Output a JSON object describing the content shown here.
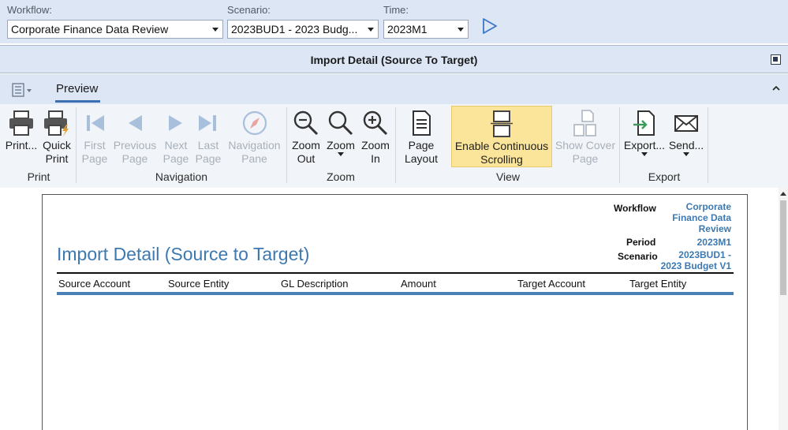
{
  "selectors": {
    "workflow": {
      "label": "Workflow:",
      "value": "Corporate Finance Data Review"
    },
    "scenario": {
      "label": "Scenario:",
      "value": "2023BUD1 - 2023 Budg..."
    },
    "time": {
      "label": "Time:",
      "value": "2023M1"
    }
  },
  "panel": {
    "title": "Import Detail (Source To Target)"
  },
  "tabs": {
    "preview": "Preview"
  },
  "ribbon": {
    "print": {
      "print": [
        "Print..."
      ],
      "quick_print": [
        "Quick",
        "Print"
      ],
      "group": "Print"
    },
    "navigation": {
      "first_page": [
        "First",
        "Page"
      ],
      "previous_page": [
        "Previous",
        "Page"
      ],
      "next_page": [
        "Next",
        "Page"
      ],
      "last_page": [
        "Last",
        "Page"
      ],
      "navigation_pane": [
        "Navigation",
        "Pane"
      ],
      "group": "Navigation"
    },
    "zoom": {
      "zoom_out": [
        "Zoom",
        "Out"
      ],
      "zoom": [
        "Zoom"
      ],
      "zoom_in": [
        "Zoom",
        "In"
      ],
      "group": "Zoom"
    },
    "view": {
      "page_layout": [
        "Page",
        "Layout"
      ],
      "continuous": [
        "Enable Continuous",
        "Scrolling"
      ],
      "cover": [
        "Show Cover",
        "Page"
      ],
      "group": "View"
    },
    "export": {
      "export": [
        "Export..."
      ],
      "send": [
        "Send..."
      ],
      "group": "Export"
    }
  },
  "report": {
    "title": "Import Detail (Source to Target)",
    "meta": {
      "workflow_label": "Workflow",
      "workflow_value": [
        "Corporate",
        "Finance Data",
        "Review"
      ],
      "period_label": "Period",
      "period_value": "2023M1",
      "scenario_label": "Scenario",
      "scenario_value": [
        "2023BUD1 -",
        "2023 Budget V1"
      ]
    },
    "columns": [
      "Source Account",
      "Source Entity",
      "GL Description",
      "Amount",
      "Target Account",
      "Target Entity"
    ]
  },
  "colors": {
    "accent": "#3c79b2",
    "highlight": "#fbe59a",
    "header_bg": "#dce6f5"
  },
  "icons": {
    "run": "play-icon",
    "app_menu": "app-menu-icon",
    "collapse": "chevron-up-icon",
    "restore": "restore-window-icon",
    "print": "printer-icon",
    "quick_print": "quick-print-icon",
    "first_page": "first-page-icon",
    "previous_page": "previous-page-icon",
    "next_page": "next-page-icon",
    "last_page": "last-page-icon",
    "navigation_pane": "compass-icon",
    "zoom_out": "zoom-out-icon",
    "zoom": "magnifier-icon",
    "zoom_in": "zoom-in-icon",
    "page_layout": "page-layout-icon",
    "continuous": "continuous-scroll-icon",
    "cover": "cover-page-icon",
    "export": "export-icon",
    "send": "email-icon"
  }
}
